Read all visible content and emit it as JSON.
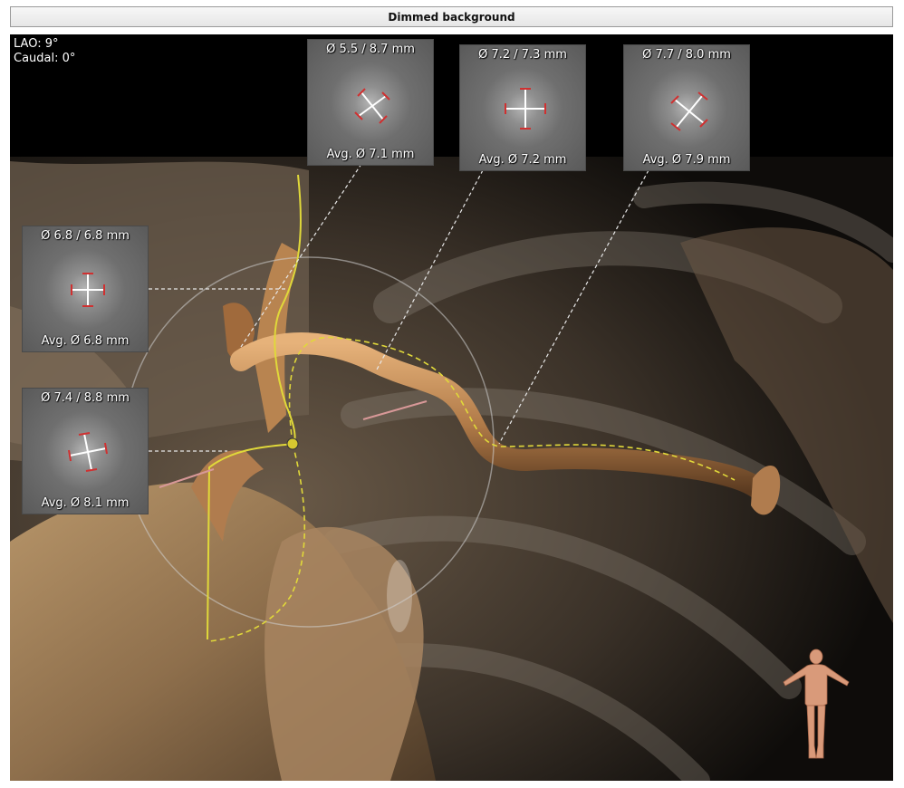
{
  "window": {
    "title": "Dimmed background"
  },
  "orientation": {
    "lao": "LAO: 9°",
    "caudal": "Caudal: 0°"
  },
  "cross_sections": [
    {
      "diameter": "Ø 5.5 / 8.7 mm",
      "average": "Avg. Ø 7.1 mm"
    },
    {
      "diameter": "Ø 7.2 / 7.3 mm",
      "average": "Avg. Ø 7.2 mm"
    },
    {
      "diameter": "Ø 7.7 / 8.0 mm",
      "average": "Avg. Ø 7.9 mm"
    },
    {
      "diameter": "Ø 6.8 / 6.8 mm",
      "average": "Avg. Ø 6.8 mm"
    },
    {
      "diameter": "Ø 7.4 / 8.8 mm",
      "average": "Avg. Ø 8.1 mm"
    }
  ],
  "colors": {
    "vessel": "#c9935c",
    "centerline": "#e0d83a",
    "caliper": "#d03030",
    "leader_line": "#e8e8e8"
  },
  "icons": {
    "orientation_figure": "human-body-icon"
  }
}
